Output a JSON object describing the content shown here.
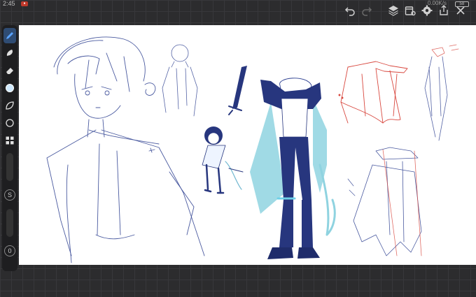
{
  "status": {
    "time": "2:45",
    "network": "0.00K/s",
    "battery": "58"
  },
  "topbar": {
    "undo_icon": "undo-icon",
    "redo_icon": "redo-icon",
    "layers_icon": "layers-icon",
    "gallery_icon": "gallery-icon",
    "settings_icon": "gear-icon",
    "share_icon": "share-icon",
    "close_icon": "close-icon"
  },
  "toolbar": {
    "tools": [
      "brush",
      "smudge",
      "eraser",
      "color",
      "shape",
      "lasso",
      "grid"
    ],
    "size_label": "S",
    "opacity_label": "0"
  },
  "canvas": {
    "background": "#ffffff"
  },
  "colors": {
    "sketch_blue": "#2a3d8f",
    "navy_fill": "#27367e",
    "cyan_fill": "#8fd3e0",
    "red_sketch": "#d8473e",
    "accent": "#3b82f6"
  }
}
